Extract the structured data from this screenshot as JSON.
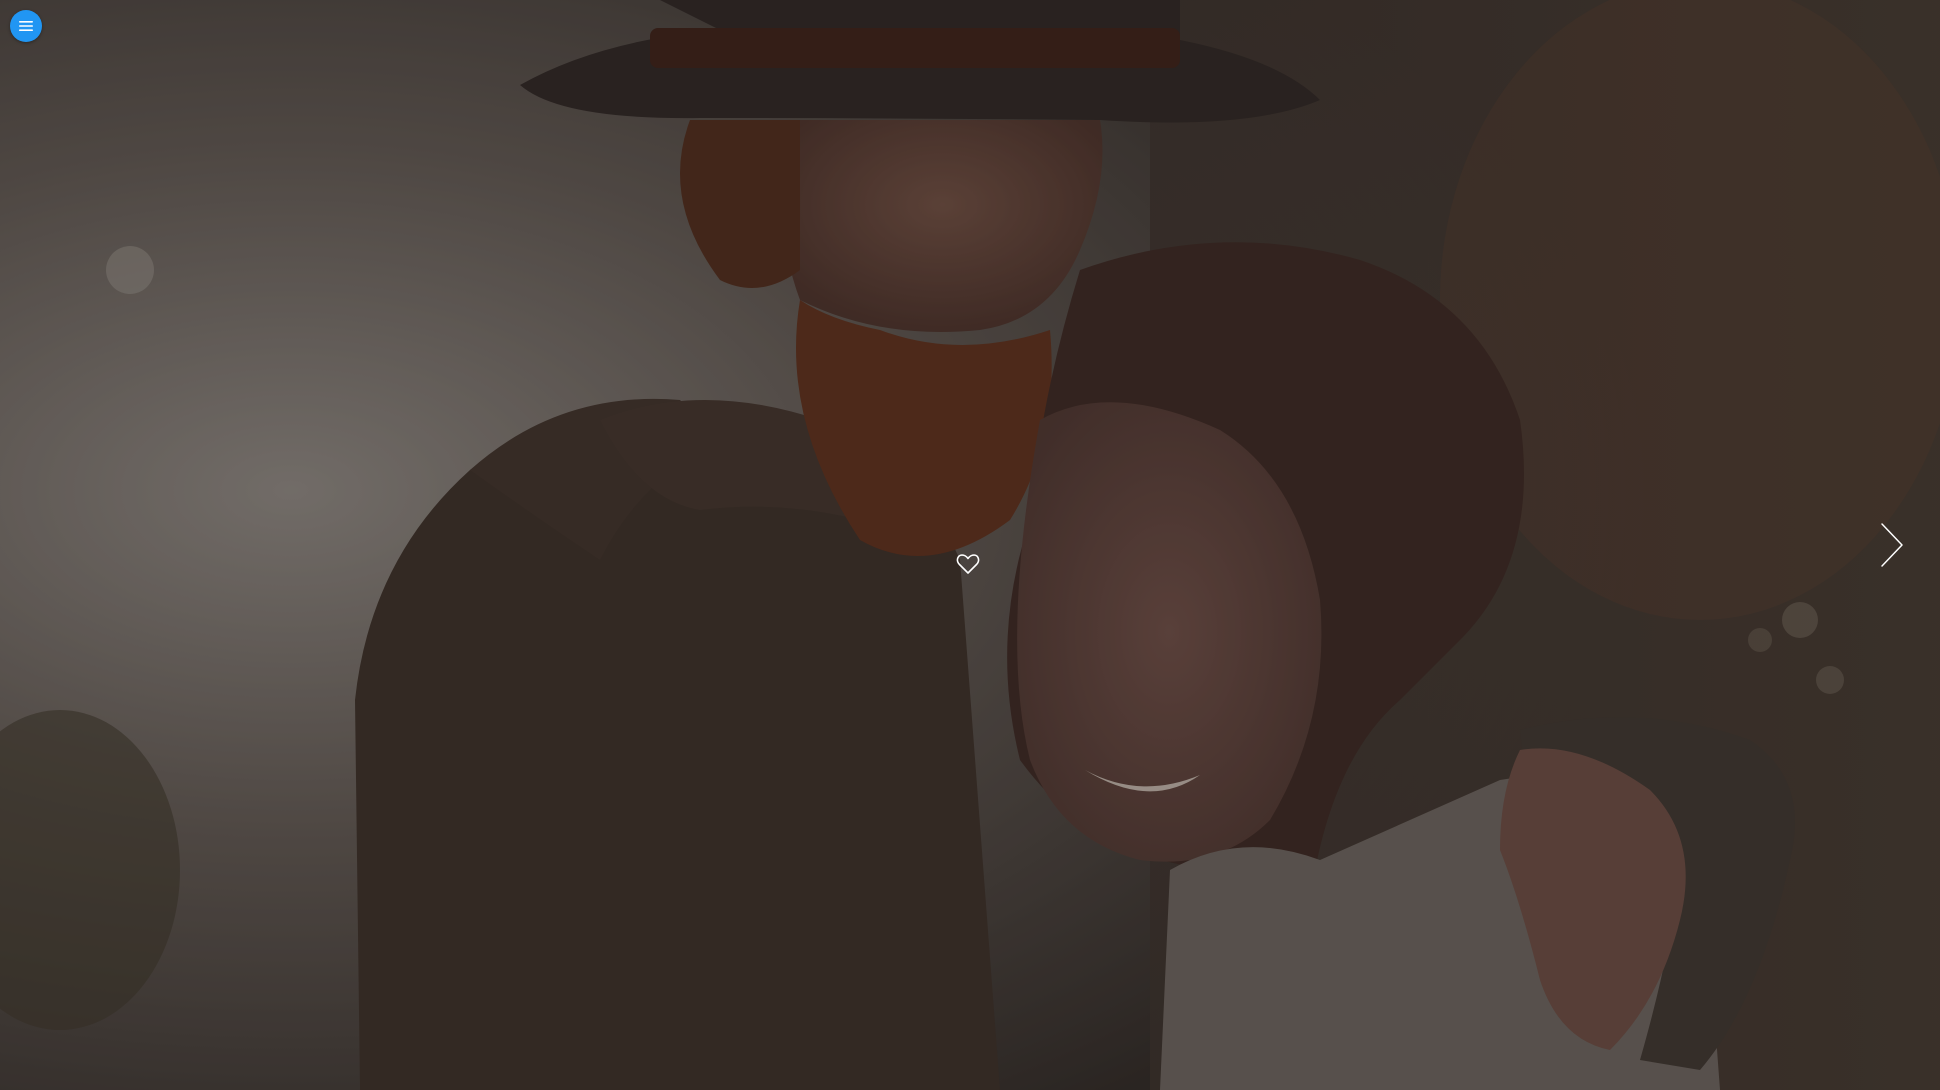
{
  "page": {
    "background": "#2c2622"
  },
  "hero": {
    "photo_description_icon": "couple-embrace-photo",
    "overlay_color": "#1e1a1a"
  },
  "menu_button": {
    "icon": "hamburger-menu-icon",
    "color": "#2196f3"
  },
  "heart": {
    "icon": "heart-outline-icon",
    "color": "#ffffff"
  },
  "next_arrow": {
    "icon": "chevron-right-icon",
    "color": "#ffffff"
  }
}
